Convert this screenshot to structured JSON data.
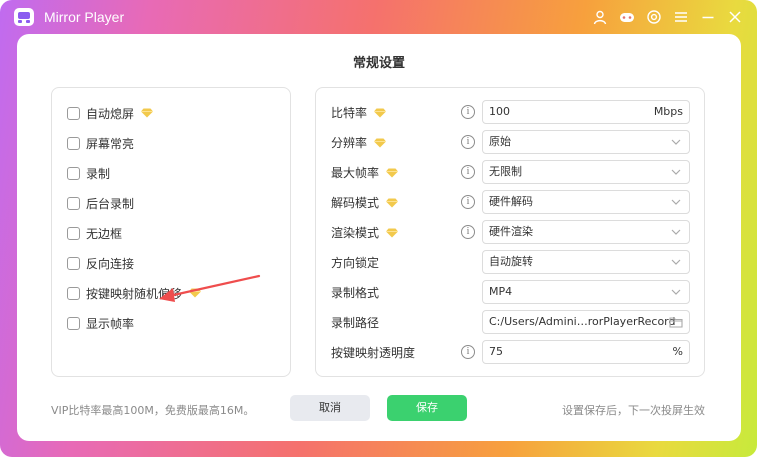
{
  "app": {
    "title": "Mirror Player"
  },
  "titlebar": {
    "icons": [
      "user-icon",
      "gamepad-icon",
      "settings-icon",
      "menu-icon",
      "minimize-icon",
      "close-icon"
    ]
  },
  "page": {
    "title": "常规设置"
  },
  "left_options": [
    {
      "label": "自动熄屏",
      "checked": false,
      "vip": true
    },
    {
      "label": "屏幕常亮",
      "checked": false,
      "vip": false
    },
    {
      "label": "录制",
      "checked": false,
      "vip": false
    },
    {
      "label": "后台录制",
      "checked": false,
      "vip": false
    },
    {
      "label": "无边框",
      "checked": false,
      "vip": false
    },
    {
      "label": "反向连接",
      "checked": false,
      "vip": false
    },
    {
      "label": "按键映射随机偏移",
      "checked": false,
      "vip": true
    },
    {
      "label": "显示帧率",
      "checked": false,
      "vip": false
    }
  ],
  "settings": {
    "bitrate": {
      "label": "比特率",
      "value": "100",
      "unit": "Mbps"
    },
    "resolution": {
      "label": "分辨率",
      "value": "原始"
    },
    "max_fps": {
      "label": "最大帧率",
      "value": "无限制"
    },
    "decode_mode": {
      "label": "解码模式",
      "value": "硬件解码"
    },
    "render_mode": {
      "label": "渲染模式",
      "value": "硬件渲染"
    },
    "orientation_lock": {
      "label": "方向锁定",
      "value": "自动旋转"
    },
    "record_format": {
      "label": "录制格式",
      "value": "MP4"
    },
    "record_path": {
      "label": "录制路径",
      "value": "C:/Users/Admini…rorPlayerRecord"
    },
    "keymap_opacity": {
      "label": "按键映射透明度",
      "value": "75",
      "unit": "%"
    }
  },
  "footer": {
    "note": "VIP比特率最高100M，免费版最高16M。",
    "cancel_label": "取消",
    "save_label": "保存",
    "hint": "设置保存后，下一次投屏生效"
  },
  "colors": {
    "save_button": "#3bd16f",
    "vip_diamond": "#f2c94c",
    "annotation_arrow": "#ef4d4d"
  }
}
